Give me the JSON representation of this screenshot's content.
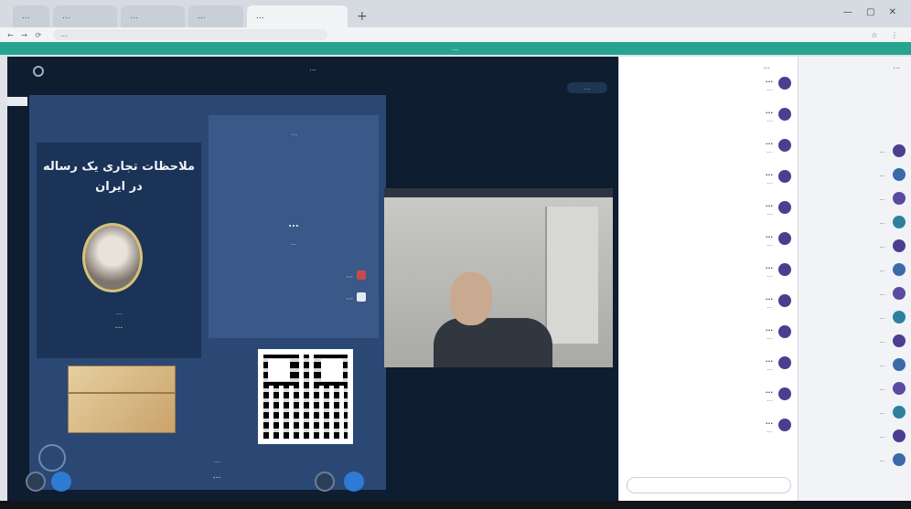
{
  "browser": {
    "tabs": [
      {
        "label": "..."
      },
      {
        "label": "..."
      },
      {
        "label": "..."
      },
      {
        "label": "..."
      },
      {
        "label": "..."
      }
    ],
    "url": "...",
    "controls": "— ▢ ✕",
    "nav": "← → ⟳",
    "tools": "☆ ⋮"
  },
  "banner": "...",
  "meeting": {
    "title": "...",
    "badge": "..."
  },
  "slide": {
    "heading": "ملاحظات تجاری یک رساله در ایران",
    "speaker_title": "...",
    "speaker_name": "...",
    "info_lines": "...",
    "date": "...",
    "time": "...",
    "org1": "...",
    "org2": "...",
    "footer_text": "...",
    "url_text": "..."
  },
  "chat": {
    "header": "...",
    "messages": [
      {
        "who": "...",
        "txt": "..."
      },
      {
        "who": "...",
        "txt": "..."
      },
      {
        "who": "...",
        "txt": "..."
      },
      {
        "who": "...",
        "txt": "..."
      },
      {
        "who": "...",
        "txt": "..."
      },
      {
        "who": "...",
        "txt": "..."
      },
      {
        "who": "...",
        "txt": "..."
      },
      {
        "who": "...",
        "txt": "..."
      },
      {
        "who": "...",
        "txt": "..."
      },
      {
        "who": "...",
        "txt": "..."
      },
      {
        "who": "...",
        "txt": "..."
      },
      {
        "who": "...",
        "txt": "..."
      }
    ],
    "input_placeholder": ""
  },
  "users": {
    "header": "...",
    "list": [
      {
        "name": "..."
      },
      {
        "name": "..."
      },
      {
        "name": "..."
      },
      {
        "name": "..."
      },
      {
        "name": "..."
      },
      {
        "name": "..."
      },
      {
        "name": "..."
      },
      {
        "name": "..."
      },
      {
        "name": "..."
      },
      {
        "name": "..."
      },
      {
        "name": "..."
      },
      {
        "name": "..."
      },
      {
        "name": "..."
      },
      {
        "name": "..."
      }
    ]
  },
  "colors": {
    "accent": "#27a48f",
    "stage": "#0e1d30",
    "slide": "#2b4874"
  }
}
